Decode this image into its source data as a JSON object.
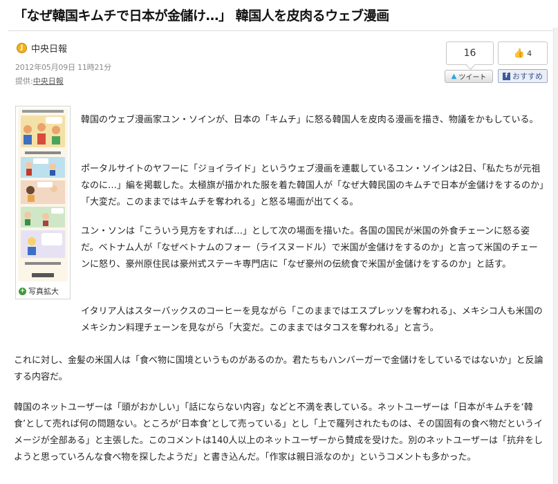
{
  "article": {
    "headline": "「なぜ韓国キムチで日本が金儲け…」 韓国人を皮肉るウェブ漫画",
    "source_logo_letter": "J",
    "source_name": "中央日報",
    "date": "2012年05月09日 11時21分",
    "credit_prefix": "提供:",
    "credit_link": "中央日報"
  },
  "social": {
    "tweet_count": "16",
    "tweet_label": "ツイート",
    "like_count": "4",
    "recommend_label": "おすすめ"
  },
  "photo": {
    "enlarge_label": "写真拡大"
  },
  "paragraphs": [
    "韓国のウェブ漫画家ユン・ソインが、日本の「キムチ」に怒る韓国人を皮肉る漫画を描き、物議をかもしている。",
    "ポータルサイトのヤフーに「ジョイライド」というウェブ漫画を連載しているユン・ソインは2日、「私たちが元祖なのに…」編を掲載した。太極旗が描かれた服を着た韓国人が「なぜ大韓民国のキムチで日本が金儲けをするのか」「大変だ。このままではキムチを奪われる」と怒る場面が出てくる。",
    "ユン・ソンは「こういう見方をすれば…」として次の場面を描いた。各国の国民が米国の外食チェーンに怒る姿だ。ベトナム人が「なぜベトナムのフォー（ライスヌードル）で米国が金儲けをするのか」と言って米国のチェーンに怒り、豪州原住民は豪州式ステーキ専門店に「なぜ豪州の伝統食で米国が金儲けをするのか」と話す。",
    "イタリア人はスターバックスのコーヒーを見ながら「このままではエスプレッソを奪われる」、メキシコ人も米国のメキシカン料理チェーンを見ながら「大変だ。このままではタコスを奪われる」と言う。",
    "これに対し、金髪の米国人は「食べ物に国境というものがあるのか。君たちもハンバーガーで金儲けをしているではないか」と反論する内容だ。",
    "韓国のネットユーザーは「頭がおかしい」「話にならない内容」などと不満を表している。ネットユーザーは「日本がキムチを‘韓食’として売れば何の問題ない。ところが‘日本食’として売っている」とし「上で羅列されたものは、その国固有の食べ物だというイメージが全部ある」と主張した。このコメントは140人以上のネットユーザーから賛成を受けた。別のネットユーザーは「抗弁をしようと思っていろんな食べ物を探したようだ」と書き込んだ。「作家は親日派なのか」というコメントも多かった。"
  ],
  "colors": {
    "tweet_bird": "#2aa3dd",
    "facebook": "#3b5998",
    "logo": "#f3b21b",
    "enlarge_icon": "#3a9b3a"
  }
}
